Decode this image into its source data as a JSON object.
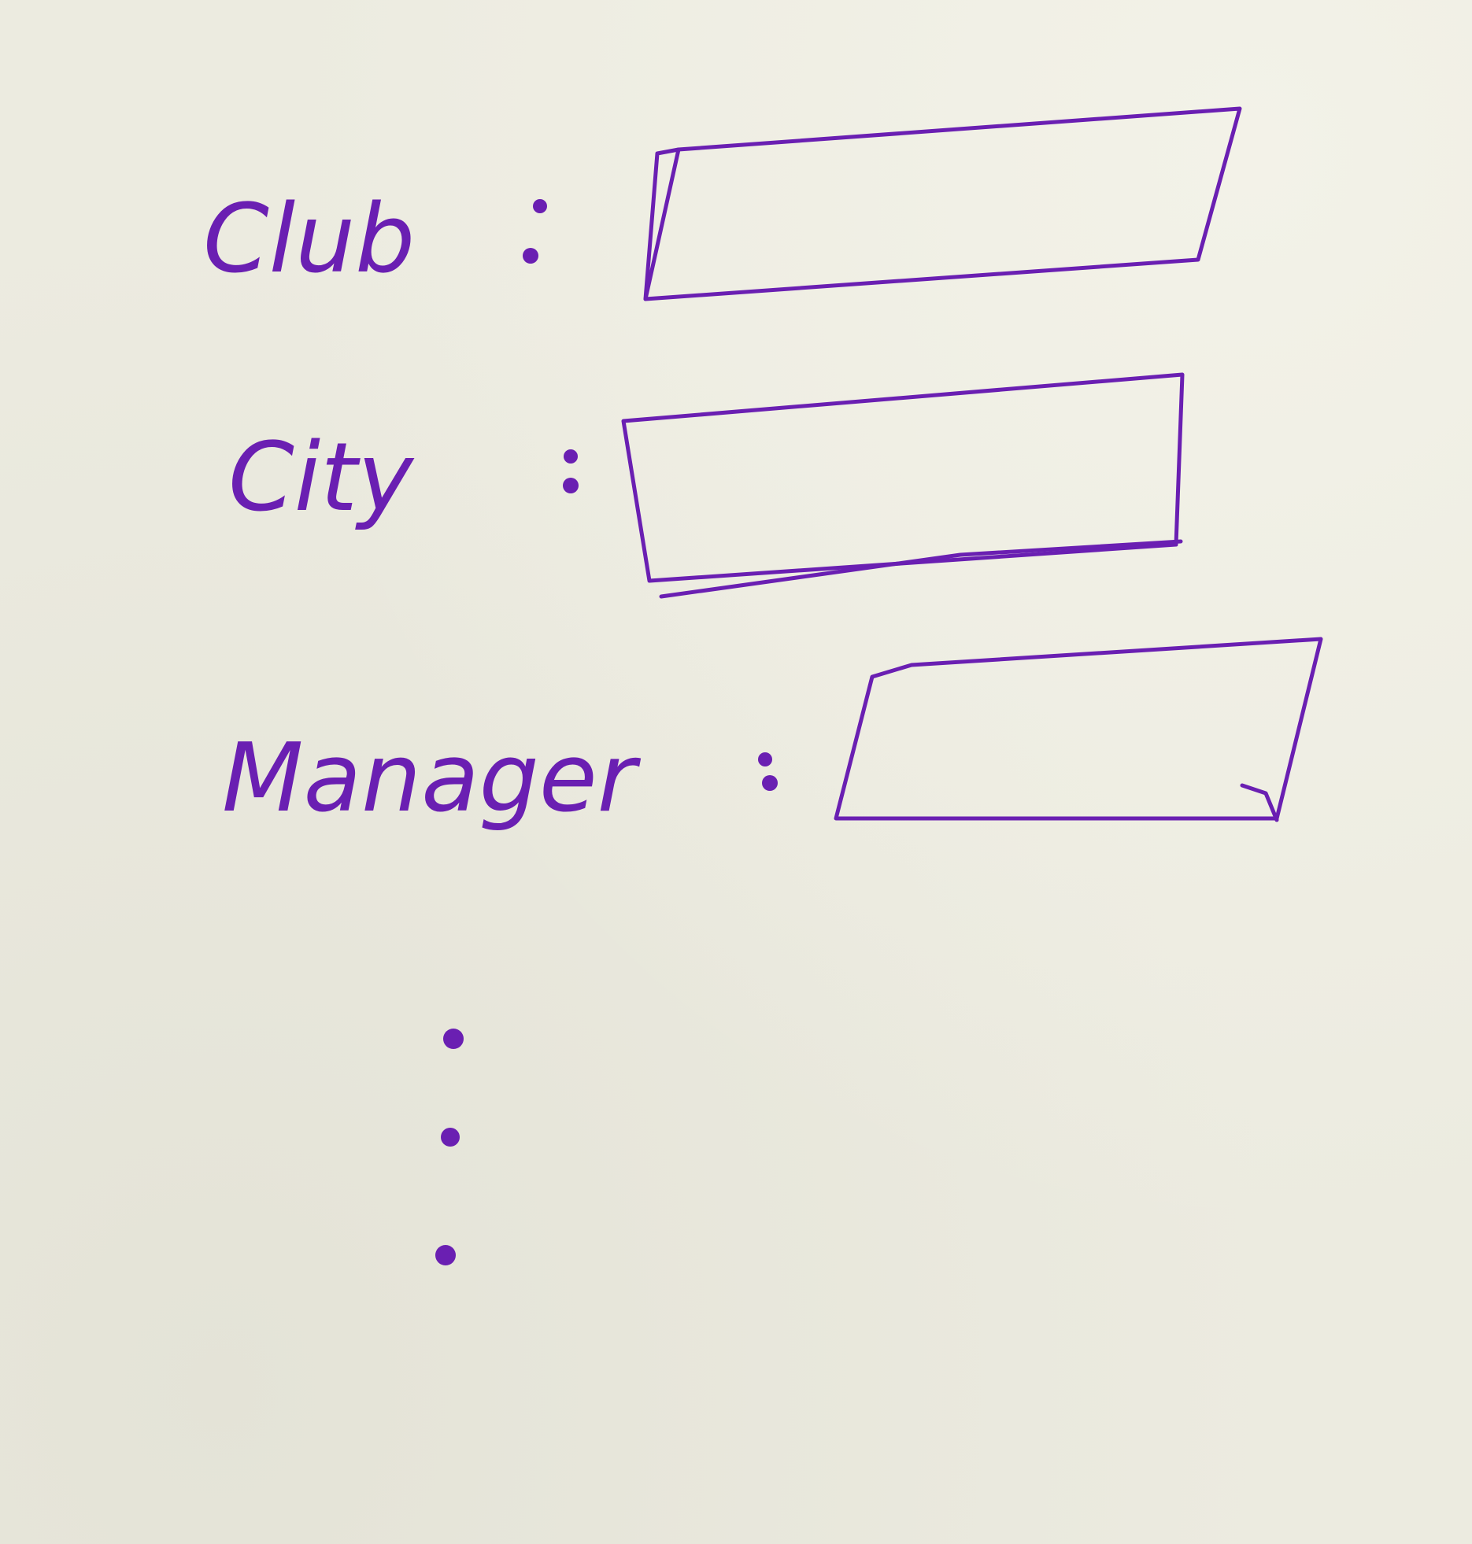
{
  "form": {
    "fields": [
      {
        "label": "Club",
        "separator": ":",
        "value": ""
      },
      {
        "label": "City",
        "separator": ":",
        "value": ""
      },
      {
        "label": "Manager",
        "separator": ":",
        "value": ""
      }
    ],
    "continuation_icon": "vertical-ellipsis-icon"
  },
  "colors": {
    "ink": "#6a1fb2",
    "paper": "#ecebe0"
  }
}
